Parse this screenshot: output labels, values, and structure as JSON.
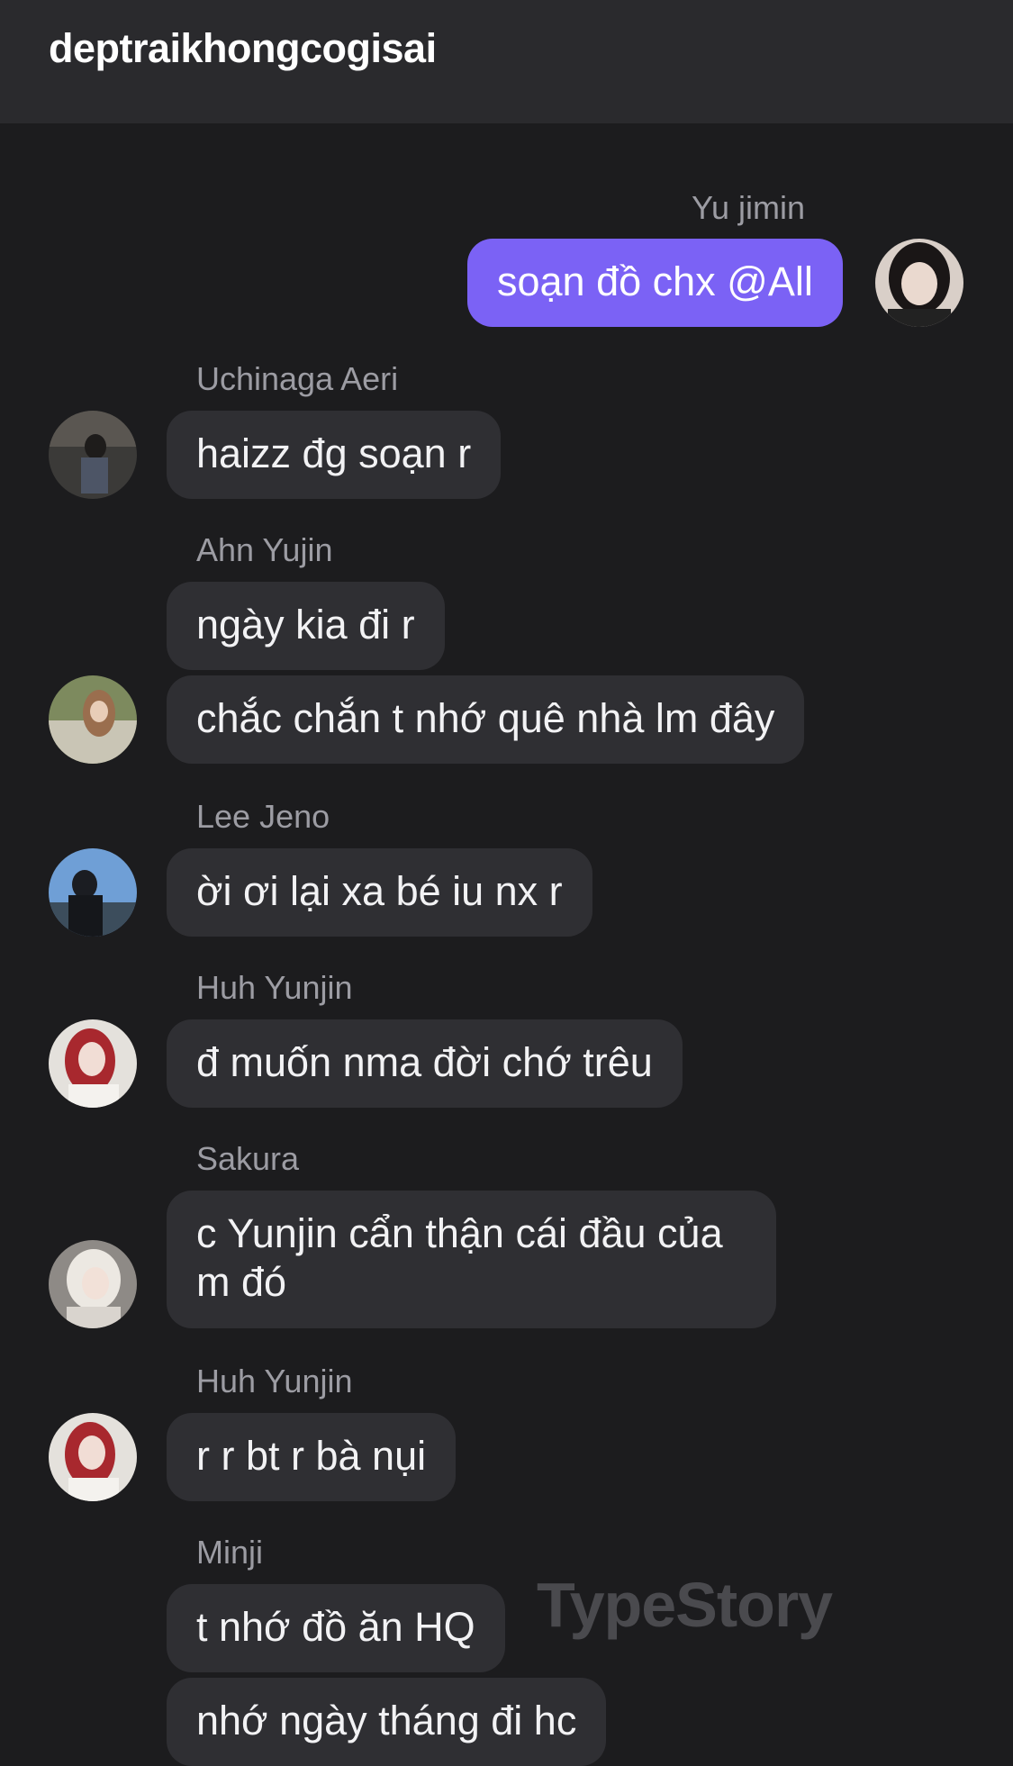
{
  "chat": {
    "title": "deptraikhongcogisai"
  },
  "messages": [
    {
      "sender": "Yu jimin",
      "texts": [
        "soạn đồ chx @All"
      ]
    },
    {
      "sender": "Uchinaga Aeri",
      "texts": [
        "haizz đg soạn r"
      ]
    },
    {
      "sender": "Ahn Yujin",
      "texts": [
        "ngày kia đi r",
        "chắc chắn t nhớ quê nhà lm đây"
      ]
    },
    {
      "sender": "Lee Jeno",
      "texts": [
        "ời ơi lại xa bé iu nx r"
      ]
    },
    {
      "sender": "Huh Yunjin",
      "texts": [
        "đ muốn nma đời chớ trêu"
      ]
    },
    {
      "sender": "Sakura",
      "texts": [
        "c Yunjin cẩn thận cái đầu của m đó"
      ]
    },
    {
      "sender": "Huh Yunjin",
      "texts": [
        "r r bt r bà nụi"
      ]
    },
    {
      "sender": "Minji",
      "texts": [
        "t nhớ đồ ăn HQ",
        "nhớ ngày tháng đi hc"
      ]
    }
  ],
  "watermark": "TypeStory",
  "colors": {
    "own_bubble": "#7b62f5",
    "other_bubble": "#2f2f33",
    "background": "#1c1c1e",
    "header": "#2a2a2d"
  }
}
